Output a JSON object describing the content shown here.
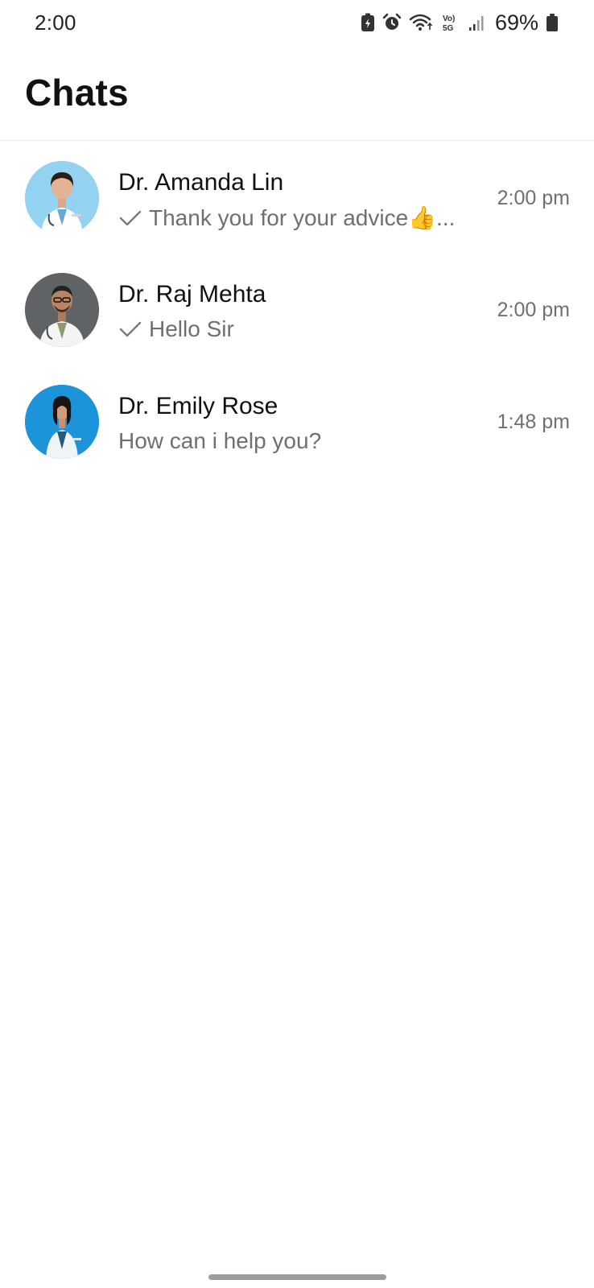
{
  "status_bar": {
    "time": "2:00",
    "battery": "69%",
    "icons": [
      "battery-saver-icon",
      "alarm-icon",
      "wifi-icon",
      "volte-5g-icon",
      "signal-icon",
      "battery-icon"
    ]
  },
  "header": {
    "title": "Chats"
  },
  "chats": [
    {
      "name": "Dr. Amanda Lin",
      "preview": "Thank you for your advice👍...",
      "time": "2:00 pm",
      "sent_check": true,
      "avatar_bg": "#8ecfee"
    },
    {
      "name": "Dr. Raj Mehta",
      "preview": "Hello Sir",
      "time": "2:00 pm",
      "sent_check": true,
      "avatar_bg": "#5f6265"
    },
    {
      "name": "Dr. Emily Rose",
      "preview": "How can i help you?",
      "time": "1:48 pm",
      "sent_check": false,
      "avatar_bg": "#1a8fd6"
    }
  ],
  "colors": {
    "text_primary": "#111111",
    "text_secondary": "#6f6f6f",
    "divider": "#ececec",
    "home_indicator": "#9c9c9c"
  }
}
